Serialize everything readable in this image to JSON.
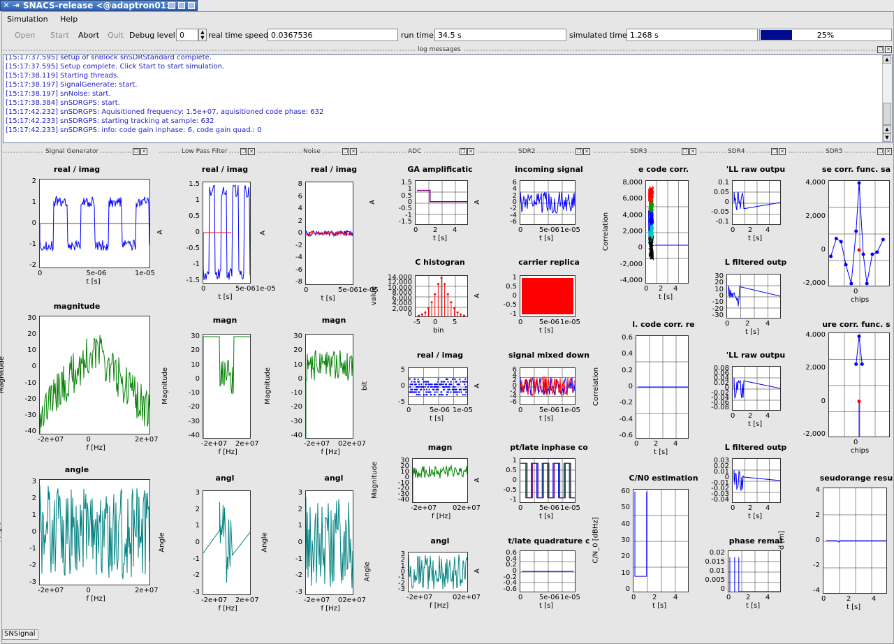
{
  "window": {
    "title": "SNACS-release <@adaptron01>"
  },
  "menu": {
    "items": [
      "Simulation",
      "Help"
    ]
  },
  "toolbar": {
    "open": "Open",
    "start": "Start",
    "abort": "Abort",
    "quit": "Quit",
    "debug_label": "Debug level:",
    "debug_value": "0",
    "rts_label": "real time speed:",
    "rts_value": "0.0367536",
    "runtime_label": "run time:",
    "runtime_value": "34.5 s",
    "simtime_label": "simulated time:",
    "simtime_value": "1.268 s",
    "progress_text": "25%",
    "progress": 0.25
  },
  "log": {
    "title": "log messages",
    "lines": [
      {
        "ts": "[15:17:37.595]",
        "msg": "setup of snBlock snSDRStandard complete."
      },
      {
        "ts": "[15:17:37.595]",
        "msg": "Setup complete. Click Start to start simulation."
      },
      {
        "ts": "[15:17:38.119]",
        "msg": "Starting  threads."
      },
      {
        "ts": "[15:17:38.197]",
        "msg": "SignalGenerate: start."
      },
      {
        "ts": "[15:17:38.197]",
        "msg": "snNoise: start."
      },
      {
        "ts": "[15:17:38.384]",
        "msg": "snSDRGPS: start."
      },
      {
        "ts": "[15:17:42.232]",
        "msg": "snSDRGPS: Aquisitioned frequency: 1.5e+07, aquisitioned code phase: 632"
      },
      {
        "ts": "[15:17:42.233]",
        "msg": "snSDRGPS: starting tracking at sample: 632"
      },
      {
        "ts": "[15:17:42.233]",
        "msg": "snSDRGPS: info: code gain inphase: 6, code gain quad.: 0"
      }
    ]
  },
  "docks": [
    "Signal Generator",
    "Low Pass Filter",
    "Noise",
    "ADC",
    "SDR2",
    "SDR3",
    "SDR4",
    "SDR5"
  ],
  "status": "SNSignal",
  "colors": {
    "blue": "#0000ff",
    "red": "#ff0000",
    "green": "#008000",
    "teal": "#008080",
    "purple": "#800080"
  },
  "plots": [
    {
      "id": "sg1",
      "title": "real / imag",
      "xlabel": "t [s]",
      "ylabel": "A",
      "xticks": [
        "0",
        "5e-06",
        "1e-05"
      ],
      "yticks": [
        "2",
        "1",
        "0",
        "-1",
        "-2"
      ]
    },
    {
      "id": "sg2",
      "title": "magnitude",
      "xlabel": "f [Hz]",
      "ylabel": "Magnitude",
      "xticks": [
        "-2e+07",
        "0",
        "2e+07"
      ],
      "yticks": [
        "30",
        "20",
        "10",
        "0",
        "-10",
        "-20",
        "-30",
        "-40"
      ]
    },
    {
      "id": "sg3",
      "title": "angle",
      "xlabel": "f [Hz]",
      "ylabel": "Angle",
      "xticks": [
        "-2e+07",
        "0",
        "2e+07"
      ],
      "yticks": [
        "3",
        "2",
        "1",
        "0",
        "-1",
        "-2",
        "-3"
      ]
    },
    {
      "id": "lp1",
      "title": "real / imag",
      "xlabel": "t [s]",
      "ylabel": "A",
      "xticks": [
        "0",
        "5e-061e-05"
      ],
      "yticks": [
        "1.5",
        "1",
        "0.5",
        "0",
        "-0.5",
        "-1",
        "-1.5"
      ]
    },
    {
      "id": "lp2",
      "title": "magn",
      "xlabel": "f [Hz]",
      "ylabel": "Magnitude",
      "xticks": [
        "-2e+07",
        "0",
        "2e+07"
      ],
      "yticks": [
        "30",
        "20",
        "10",
        "0",
        "-10",
        "-20",
        "-30",
        "-40"
      ]
    },
    {
      "id": "lp3",
      "title": "angl",
      "xlabel": "f [Hz]",
      "ylabel": "Angle",
      "xticks": [
        "-2e+07",
        "0",
        "2e+07"
      ],
      "yticks": [
        "3",
        "2",
        "1",
        "0",
        "-1",
        "-2",
        "-3"
      ]
    },
    {
      "id": "no1",
      "title": "real / imag",
      "xlabel": "t [s]",
      "ylabel": "A",
      "xticks": [
        "0",
        "5e-061e-05"
      ],
      "yticks": [
        "8",
        "6",
        "4",
        "2",
        "0",
        "-2",
        "-4",
        "-6",
        "-8"
      ]
    },
    {
      "id": "no2",
      "title": "magn",
      "xlabel": "f [Hz]",
      "ylabel": "Magnitude",
      "xticks": [
        "-2e+07",
        "02e+07"
      ],
      "yticks": [
        "30",
        "20",
        "10",
        "0",
        "-10",
        "-20",
        "-30",
        "-40"
      ]
    },
    {
      "id": "no3",
      "title": "angl",
      "xlabel": "f [Hz]",
      "ylabel": "Angle",
      "xticks": [
        "-2e+07",
        "02e+07"
      ],
      "yticks": [
        "3",
        "2",
        "1",
        "0",
        "-1",
        "-2",
        "-3"
      ]
    },
    {
      "id": "adc1",
      "title": "GA amplificatic",
      "xlabel": "t [s]",
      "ylabel": "A",
      "xticks": [
        "0",
        "2",
        "4"
      ],
      "yticks": [
        "1.5",
        "1",
        "0.5",
        "0",
        "-0.5",
        "-1",
        "-1.5"
      ]
    },
    {
      "id": "adc2",
      "title": "C histogran",
      "xlabel": "bin",
      "ylabel": "value",
      "xticks": [
        "-5",
        "0",
        "5"
      ],
      "yticks": [
        "14,000",
        "12,000",
        "10,000",
        "8,000",
        "6,000",
        "4,000",
        "2,000",
        "0"
      ]
    },
    {
      "id": "adc3",
      "title": "real / imag",
      "xlabel": "t [s]",
      "ylabel": "bit",
      "xticks": [
        "0",
        "5e-06",
        "1e-05"
      ],
      "yticks": [
        "5",
        "0",
        "-5"
      ]
    },
    {
      "id": "adc4",
      "title": "magn",
      "xlabel": "f [Hz]",
      "ylabel": "Magnitude",
      "xticks": [
        "-2e+07",
        "02e+07"
      ],
      "yticks": [
        "30",
        "20",
        "10",
        "0",
        "-10",
        "-20",
        "-30",
        "-40"
      ]
    },
    {
      "id": "adc5",
      "title": "angl",
      "xlabel": "f [Hz]",
      "ylabel": "Angle",
      "xticks": [
        "-2e+07",
        "02e+07"
      ],
      "yticks": [
        "3",
        "2",
        "1",
        "0",
        "-1",
        "-2",
        "-3"
      ]
    },
    {
      "id": "sdr2a",
      "title": "incoming signal",
      "xlabel": "t [s]",
      "ylabel": "A",
      "xticks": [
        "0",
        "5e-06",
        "1e-05"
      ],
      "yticks": [
        "6",
        "4",
        "2",
        "0",
        "-2",
        "-4",
        "-6"
      ]
    },
    {
      "id": "sdr2b",
      "title": "carrier replica",
      "xlabel": "t [s]",
      "ylabel": "A",
      "xticks": [
        "0",
        "5e-06",
        "1e-05"
      ],
      "yticks": [
        "1",
        "0.5",
        "0",
        "-0.5",
        "-1"
      ]
    },
    {
      "id": "sdr2c",
      "title": "signal mixed down",
      "xlabel": "t [s]",
      "ylabel": "A",
      "xticks": [
        "0",
        "5e-06",
        "1e-05"
      ],
      "yticks": [
        "6",
        "4",
        "2",
        "0",
        "-2",
        "-4",
        "-6"
      ]
    },
    {
      "id": "sdr2d",
      "title": "pt/late inphase co",
      "xlabel": "t [s]",
      "ylabel": "A",
      "xticks": [
        "0",
        "5e-06",
        "1e-05"
      ],
      "yticks": [
        "1",
        "0.5",
        "0",
        "-0.5",
        "-1"
      ]
    },
    {
      "id": "sdr2e",
      "title": "t/late quadrature c",
      "xlabel": "t [s]",
      "ylabel": "A",
      "xticks": [
        "0",
        "5e-06",
        "1e-05"
      ],
      "yticks": [
        "0.6",
        "0.4",
        "0.2",
        "0",
        "-0.2",
        "-0.4",
        "-0.6"
      ]
    },
    {
      "id": "sdr3a",
      "title": "e code corr.",
      "xlabel": "t [s]",
      "ylabel": "Correlation",
      "xticks": [
        "0",
        "2",
        "4"
      ],
      "yticks": [
        "8,000",
        "6,000",
        "4,000",
        "2,000",
        "0",
        "-2,000",
        "-4,000"
      ]
    },
    {
      "id": "sdr3b",
      "title": "l. code corr. re",
      "xlabel": "t [s]",
      "ylabel": "Correlation",
      "xticks": [
        "0",
        "2",
        "4"
      ],
      "yticks": [
        "0.6",
        "0.4",
        "0.2",
        "0",
        "-0.2",
        "-0.4",
        "-0.6"
      ]
    },
    {
      "id": "sdr3c",
      "title": "C/N0 estimation",
      "xlabel": "t [s]",
      "ylabel": "C/N_0 [dBHz]",
      "xticks": [
        "0",
        "2",
        "4"
      ],
      "yticks": [
        "60",
        "50",
        "40",
        "30",
        "20",
        "10",
        "0"
      ]
    },
    {
      "id": "sdr4a",
      "title": "'LL raw outpu",
      "xlabel": "t [s]",
      "ylabel": "",
      "xticks": [
        "0",
        "2",
        "4"
      ],
      "yticks": [
        "0.1",
        "0.05",
        "0",
        "-0.05",
        "-0.1"
      ]
    },
    {
      "id": "sdr4b",
      "title": "L filtered outp",
      "xlabel": "t [s]",
      "ylabel": "",
      "xticks": [
        "0",
        "2",
        "4"
      ],
      "yticks": [
        "30",
        "20",
        "10",
        "0",
        "-10",
        "-20",
        "-30"
      ]
    },
    {
      "id": "sdr4c",
      "title": "'LL raw outpu",
      "xlabel": "t [s]",
      "ylabel": "",
      "xticks": [
        "0",
        "2",
        "4"
      ],
      "yticks": [
        "0.08",
        "0.06",
        "0.04",
        "0.02",
        "0",
        "-0.02",
        "-0.04",
        "-0.06",
        "-0.08"
      ]
    },
    {
      "id": "sdr4d",
      "title": "L filtered outp",
      "xlabel": "t [s]",
      "ylabel": "",
      "xticks": [
        "0",
        "2",
        "4"
      ],
      "yticks": [
        "0.03",
        "0.02",
        "0.01",
        "0",
        "-0.01",
        "-0.02",
        "-0.03",
        "-0.04"
      ]
    },
    {
      "id": "sdr4e",
      "title": "phase remai",
      "xlabel": "t [s]",
      "ylabel": "",
      "xticks": [
        "0",
        "2",
        "4"
      ],
      "yticks": [
        "0.02",
        "0.015",
        "0.01",
        "0.005",
        "0"
      ]
    },
    {
      "id": "sdr5a",
      "title": "se corr. func. sa",
      "xlabel": "chips",
      "ylabel": "",
      "xticks": [
        "0"
      ],
      "yticks": [
        "4,000",
        "2,000",
        "0",
        "-2,000"
      ]
    },
    {
      "id": "sdr5b",
      "title": "ure corr. func. s",
      "xlabel": "chips",
      "ylabel": "",
      "xticks": [
        "0"
      ],
      "yticks": [
        "4,000",
        "2,000",
        "0",
        "-2,000"
      ]
    },
    {
      "id": "sdr5c",
      "title": "seudorange resu",
      "xlabel": "t [s]",
      "ylabel": "d [m]",
      "xticks": [
        "0",
        "2",
        "4"
      ],
      "yticks": [
        "4",
        "2",
        "0",
        "-2",
        "-4"
      ]
    }
  ]
}
